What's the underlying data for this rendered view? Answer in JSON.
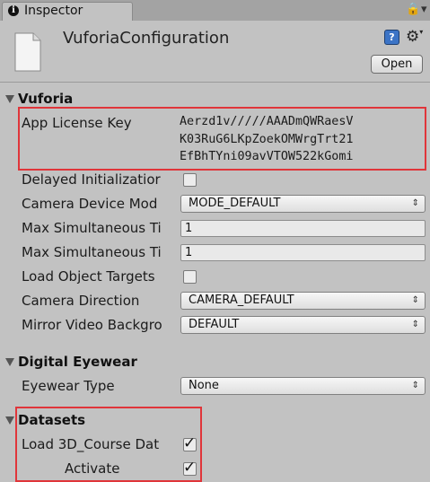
{
  "tab": {
    "label": "Inspector",
    "icon": "info-icon"
  },
  "toolbar": {
    "lock_icon": "lock-icon",
    "menu_icon": "tab-menu-icon"
  },
  "header": {
    "object_name": "VuforiaConfiguration",
    "open_label": "Open",
    "file_icon": "file-icon",
    "help_icon": "help-icon",
    "settings_icon": "gear-icon"
  },
  "vuforia": {
    "title": "Vuforia",
    "license_label": "App License Key",
    "license_lines": [
      "Aerzd1v/////AAADmQWRaesV",
      "K03RuG6LKpZoekOMWrgTrt21",
      "EfBhTYni09avVTOW522kGomi"
    ],
    "delayed_init_label": "Delayed Initializatior",
    "delayed_init_checked": false,
    "camera_mode_label": "Camera Device Mod",
    "camera_mode_value": "MODE_DEFAULT",
    "max_targets_label": "Max Simultaneous Ti",
    "max_targets_value": "1",
    "max_objects_label": "Max Simultaneous Ti",
    "max_objects_value": "1",
    "load_objects_label": "Load Object Targets",
    "load_objects_checked": false,
    "camera_direction_label": "Camera Direction",
    "camera_direction_value": "CAMERA_DEFAULT",
    "mirror_label": "Mirror Video Backgro",
    "mirror_value": "DEFAULT"
  },
  "digital_eyewear": {
    "title": "Digital Eyewear",
    "eyewear_type_label": "Eyewear Type",
    "eyewear_type_value": "None"
  },
  "datasets": {
    "title": "Datasets",
    "load_label": "Load 3D_Course Dat",
    "load_checked": true,
    "activate_label": "Activate",
    "activate_checked": true
  },
  "colors": {
    "highlight": "#e0353a",
    "panel": "#c2c2c2",
    "tab_bar": "#a3a3a3"
  }
}
